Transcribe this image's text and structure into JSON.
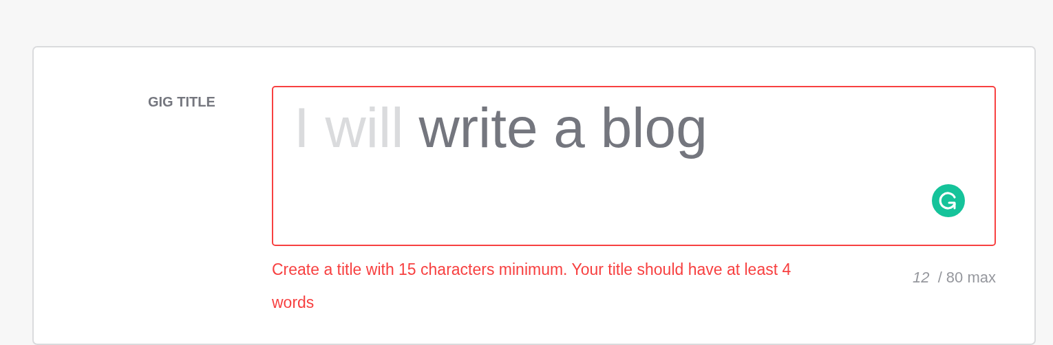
{
  "gig_title": {
    "label": "GIG TITLE",
    "prefix": "I will",
    "value": "write a blog",
    "invalid": true,
    "error": "Create a title with 15 characters minimum. Your title should have at least 4 words",
    "counter": {
      "current": "12",
      "max": "/ 80 max"
    }
  }
}
